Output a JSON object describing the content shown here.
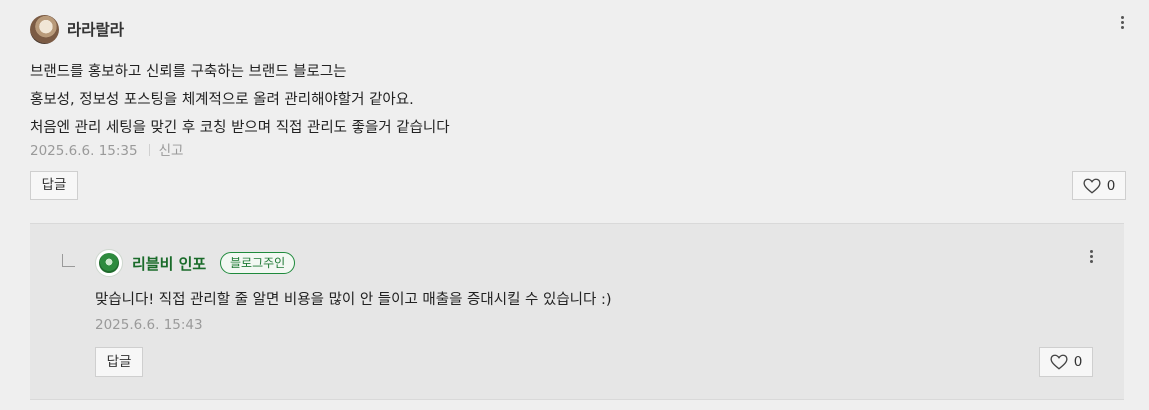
{
  "comment": {
    "author": "라라랄라",
    "lines": [
      "브랜드를 홍보하고 신뢰를 구축하는 브랜드 블로그는",
      "홍보성, 정보성 포스팅을 체계적으로 올려 관리해야할거 같아요.",
      "처음엔 관리 세팅을 맞긴 후 코칭 받으며 직접 관리도 좋을거 같습니다"
    ],
    "date": "2025.6.6. 15:35",
    "report_label": "신고",
    "reply_button": "답글",
    "like_count": "0",
    "icons": {
      "more": "more-vertical-icon",
      "like": "heart-icon",
      "avatar": "user-avatar"
    }
  },
  "reply": {
    "author": "리블비 인포",
    "badge": "블로그주인",
    "text": "맞습니다! 직접 관리할 줄 알면 비용을 많이 안 들이고 매출을 증대시킬 수 있습니다 :)",
    "date": "2025.6.6. 15:43",
    "reply_button": "답글",
    "like_count": "0",
    "icons": {
      "more": "more-vertical-icon",
      "like": "heart-icon",
      "reply_indicator": "reply-arrow-icon",
      "avatar": "blog-logo"
    }
  },
  "colors": {
    "owner_green": "#1a6b2a",
    "background": "#efefef",
    "reply_background": "#e6e6e6"
  }
}
